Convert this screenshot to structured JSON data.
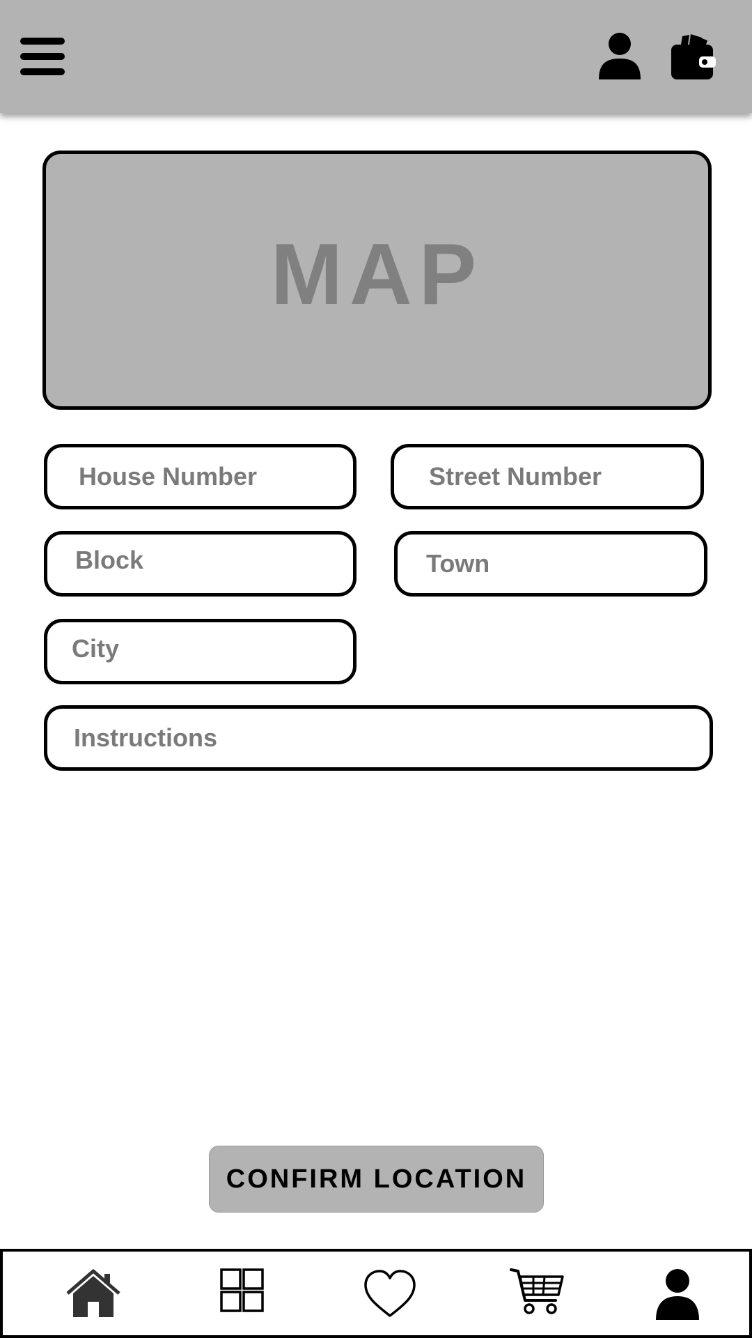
{
  "header": {
    "menu_icon": "hamburger-menu-icon",
    "user_icon": "user-icon",
    "wallet_icon": "wallet-icon",
    "background": "#b3b3b3"
  },
  "map": {
    "label": "MAP",
    "background": "#b3b3b3",
    "label_color": "#808080"
  },
  "form": {
    "house_number": {
      "placeholder": "House Number",
      "value": ""
    },
    "street_number": {
      "placeholder": "Street Number",
      "value": ""
    },
    "block": {
      "placeholder": "Block",
      "value": ""
    },
    "town": {
      "placeholder": "Town",
      "value": ""
    },
    "city": {
      "placeholder": "City",
      "value": ""
    },
    "instructions": {
      "placeholder": "Instructions",
      "value": ""
    }
  },
  "confirm_button": {
    "label": "CONFIRM LOCATION"
  },
  "bottom_nav": {
    "items": [
      {
        "icon": "home-icon"
      },
      {
        "icon": "grid-icon"
      },
      {
        "icon": "heart-icon"
      },
      {
        "icon": "cart-icon"
      },
      {
        "icon": "profile-icon"
      }
    ]
  }
}
